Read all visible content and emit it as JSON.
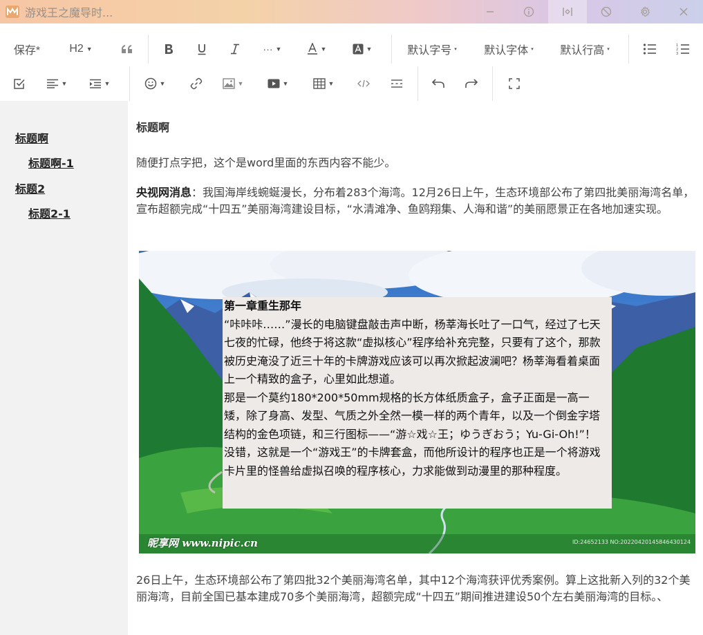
{
  "window": {
    "title": "游戏王之魔导时..."
  },
  "toolbar": {
    "save_label": "保存*",
    "heading_label": "H2",
    "font_size_label": "默认字号",
    "font_family_label": "默认字体",
    "line_height_label": "默认行高",
    "icons": [
      "quote-icon",
      "bold-icon",
      "underline-icon",
      "italic-icon",
      "more-icon",
      "font-color-icon",
      "background-color-icon",
      "bullet-list-icon",
      "numbered-list-icon",
      "checkbox-icon",
      "align-icon",
      "indent-icon",
      "emoji-icon",
      "link-icon",
      "image-icon",
      "video-icon",
      "table-icon",
      "code-icon",
      "divider-icon",
      "undo-icon",
      "redo-icon",
      "fullscreen-icon"
    ]
  },
  "sidebar": {
    "items": [
      {
        "label": "标题啊"
      },
      {
        "label": "标题啊-1"
      },
      {
        "label": "标题2"
      },
      {
        "label": "标题2-1"
      }
    ]
  },
  "content": {
    "heading": "标题啊",
    "para1": "随便打点字把，这个是word里面的东西内容不能少。",
    "para2_bold": "央视网消息",
    "para2": "：我国海岸线蜿蜒漫长，分布着283个海湾。12月26日上午，生态环境部公布了第四批美丽海湾名单，宣布超额完成“十四五”美丽海湾建设目标，“水清滩净、鱼鸥翔集、人海和谐”的美丽愿景正在各地加速实现。",
    "overlay_title": "第一章重生那年",
    "overlay_p1": "“咔咔咔……”漫长的电脑键盘敲击声中断，杨莘海长吐了一口气，经过了七天七夜的忙碌，他终于将这款“虚拟核心”程序给补充完整，只要有了这个，那款被历史淹没了近三十年的卡牌游戏应该可以再次掀起波澜吧？杨莘海看着桌面上一个精致的盒子，心里如此想道。",
    "overlay_p2": "那是一个莫约180*200*50mm规格的长方体纸质盒子，盒子正面是一高一矮，除了身高、发型、气质之外全然一模一样的两个青年，以及一个倒金字塔结构的金色项链，和三行图标——“游☆戏☆王；ゆうぎおう；Yu-Gi-Oh!”！",
    "overlay_p3": "没错，这就是一个“游戏王”的卡牌套盒，而他所设计的程序也正是一个将游戏卡片里的怪兽给虚拟召唤的程序核心，力求能做到动漫里的那种程度。",
    "watermark": "昵享网 www.nipic.cn",
    "watermark_id": "ID:24652133 NO:20220420145846430124",
    "para3": "26日上午，生态环境部公布了第四批32个美丽海湾名单，其中12个海湾获评优秀案例。算上这批新入列的32个美丽海湾，目前全国已基本建成70多个美丽海湾，超额完成“十四五”期间推进建设50个左右美丽海湾的目标。、"
  }
}
